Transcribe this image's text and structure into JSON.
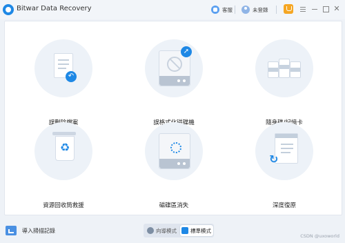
{
  "app": {
    "title": "Bitwar Data Recovery"
  },
  "titlebar": {
    "service_label": "客服",
    "login_label": "未登錄"
  },
  "tiles": [
    {
      "label": "誤刪除檔案",
      "icon": "deleted-file-icon"
    },
    {
      "label": "誤格式化磁碟機",
      "icon": "formatted-drive-icon"
    },
    {
      "label": "隨身碟/記憶卡",
      "icon": "usb-card-icon"
    },
    {
      "label": "資源回收筒救援",
      "icon": "recycle-bin-icon"
    },
    {
      "label": "磁碟區消失",
      "icon": "lost-partition-icon"
    },
    {
      "label": "深度復原",
      "icon": "deep-recovery-icon"
    }
  ],
  "footer": {
    "import_label": "導入掃描記錄",
    "modes": [
      {
        "label": "向導模式",
        "active": false
      },
      {
        "label": "標準模式",
        "active": true
      }
    ],
    "watermark": "CSDN @uxoworld"
  },
  "colors": {
    "accent": "#1e88e5",
    "cart": "#f5a623",
    "background": "#eef2f7"
  }
}
